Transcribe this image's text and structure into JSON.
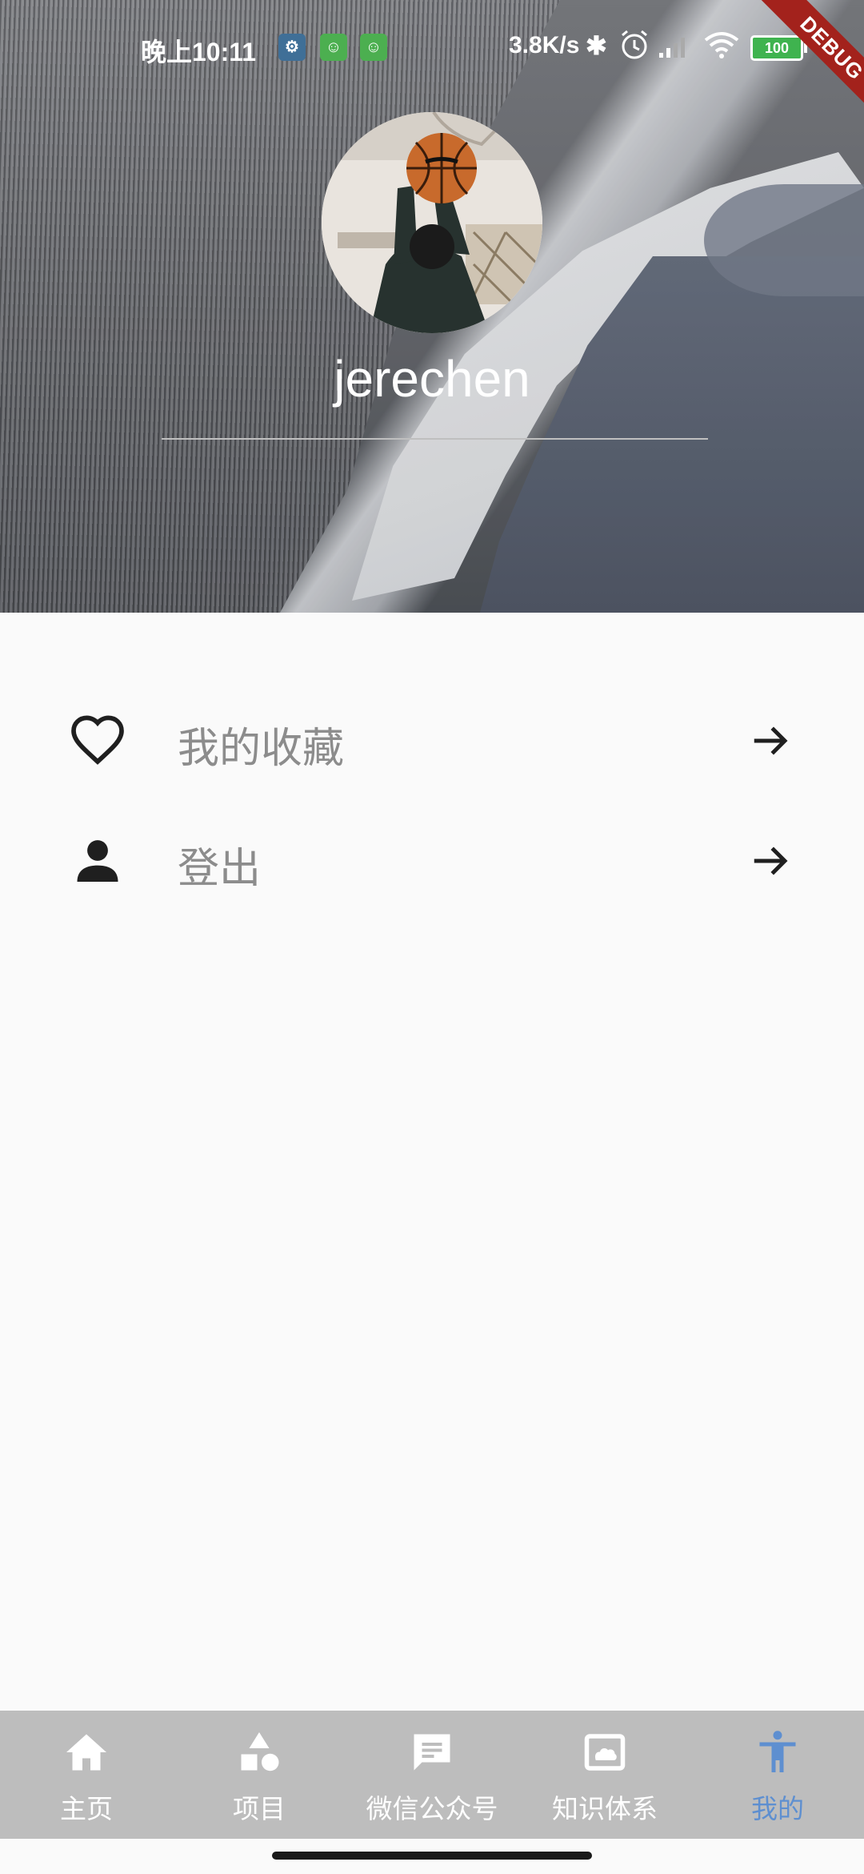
{
  "status_bar": {
    "time": "晚上10:11",
    "network_speed": "3.8K/s",
    "battery": "100"
  },
  "debug_banner": "DEBUG",
  "profile": {
    "username": "jerechen"
  },
  "menu": [
    {
      "label": "我的收藏",
      "icon": "heart-outline-icon",
      "trailing_icon": "arrow-forward-icon"
    },
    {
      "label": "登出",
      "icon": "person-icon",
      "trailing_icon": "arrow-forward-icon"
    }
  ],
  "bottom_nav": {
    "active_index": 4,
    "active_color": "#5e8fd0",
    "background": "#bdbdbd",
    "items": [
      {
        "label": "主页",
        "icon": "home-icon"
      },
      {
        "label": "项目",
        "icon": "category-icon"
      },
      {
        "label": "微信公众号",
        "icon": "chat-bubble-icon"
      },
      {
        "label": "知识体系",
        "icon": "cloud-picture-icon"
      },
      {
        "label": "我的",
        "icon": "accessibility-icon"
      }
    ]
  }
}
